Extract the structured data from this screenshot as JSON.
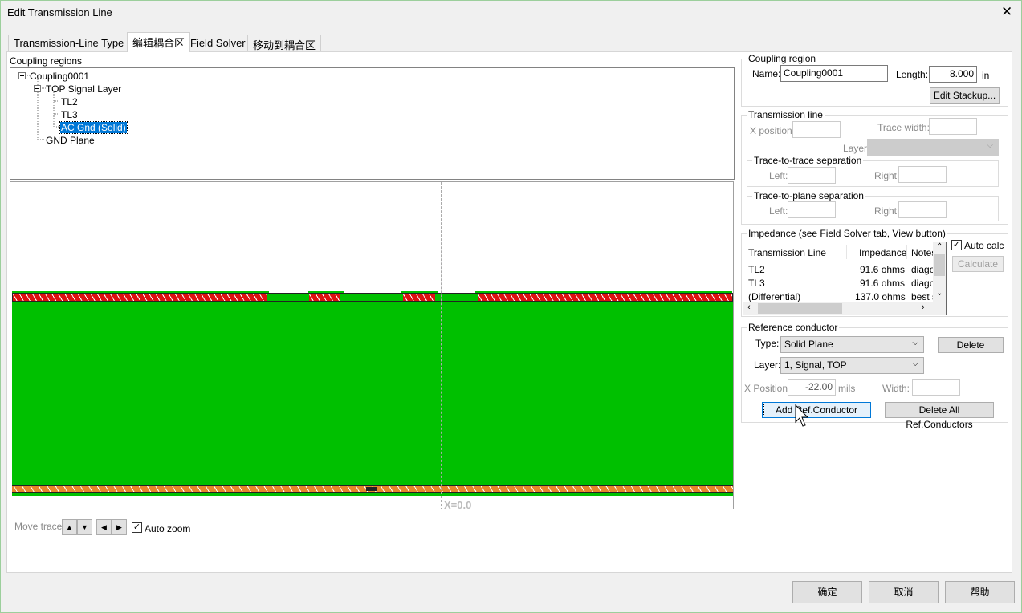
{
  "window": {
    "title": "Edit Transmission Line",
    "close_icon": "close-icon"
  },
  "tabs": [
    {
      "label": "Transmission-Line Type"
    },
    {
      "label": "编辑耦合区",
      "active": true
    },
    {
      "label": "Field Solver"
    },
    {
      "label": "移动到耦合区"
    }
  ],
  "tree": {
    "label": "Coupling regions",
    "nodes": [
      "Coupling0001",
      "TOP Signal Layer",
      "TL2",
      "TL3",
      "AC Gnd (Solid)",
      "GND Plane"
    ],
    "selected": "AC Gnd (Solid)"
  },
  "canvas": {
    "x_label": "X=0.0",
    "colors": {
      "dielectric": "#00c000",
      "top_plane": "#d11111",
      "bottom_plane": "#e6862a"
    }
  },
  "move": {
    "label": "Move trace:",
    "auto_zoom_label": "Auto zoom",
    "auto_zoom_checked": true
  },
  "coupling_region": {
    "title": "Coupling region",
    "name_label": "Name:",
    "name_value": "Coupling0001",
    "length_label": "Length:",
    "length_value": "8.000",
    "length_unit": "in",
    "edit_stackup": "Edit Stackup..."
  },
  "transmission_line": {
    "title": "Transmission line",
    "x_position_label": "X position:",
    "trace_width_label": "Trace width:",
    "layer_label": "Layer",
    "t2t_title": "Trace-to-trace separation",
    "t2p_title": "Trace-to-plane separation",
    "left_label": "Left:",
    "right_label": "Right:"
  },
  "impedance": {
    "title": "Impedance (see Field Solver tab, View button)",
    "columns": [
      "Transmission Line",
      "Impedance",
      "Notes"
    ],
    "rows": [
      [
        "TL2",
        "91.6 ohms",
        "diago"
      ],
      [
        "TL3",
        "91.6 ohms",
        "diago"
      ],
      [
        "(Differential)",
        "137.0 ohms",
        "best s"
      ]
    ],
    "auto_calc_label": "Auto calc",
    "auto_calc_checked": true,
    "calculate": "Calculate"
  },
  "reference": {
    "title": "Reference conductor",
    "type_label": "Type:",
    "type_value": "Solid Plane",
    "delete": "Delete",
    "layer_label": "Layer:",
    "layer_value": "1, Signal, TOP",
    "xpos_label": "X Position:",
    "xpos_value": "-22.00",
    "xpos_unit": "mils",
    "width_label": "Width:",
    "add": "Add Ref.Conductor",
    "delete_all": "Delete All Ref.Conductors"
  },
  "footer": {
    "ok": "确定",
    "cancel": "取消",
    "help": "帮助"
  }
}
